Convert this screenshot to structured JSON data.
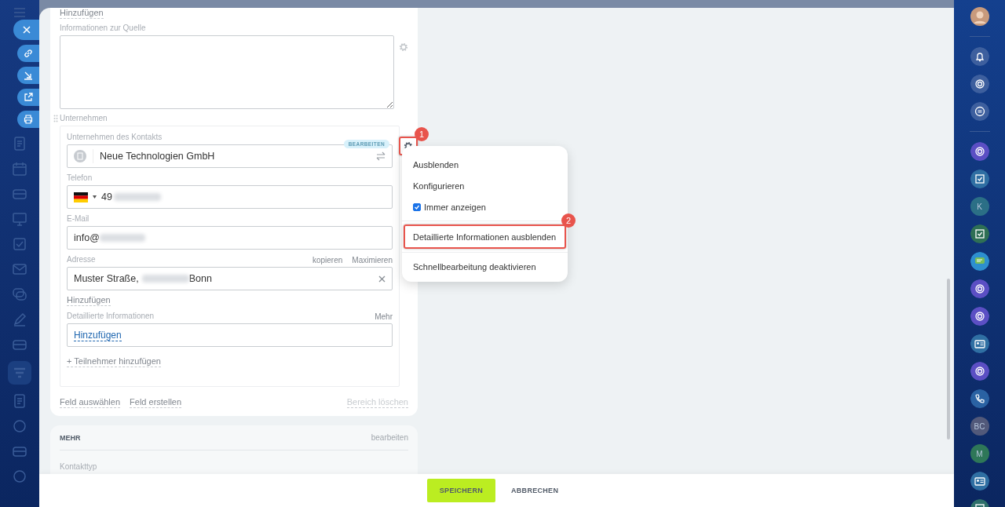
{
  "source_section": {
    "add_link": "Hinzufügen",
    "label": "Informationen zur Quelle"
  },
  "company_section": {
    "title": "Unternehmen",
    "field_label": "Unternehmen des Kontakts",
    "badge": "BEARBEITEN",
    "company": "Neue Technologien GmbH",
    "gear_callout": "1",
    "phone": {
      "label": "Telefon",
      "value": "49"
    },
    "email": {
      "label": "E-Mail",
      "value": "info@"
    },
    "address": {
      "label": "Adresse",
      "actions": [
        "kopieren",
        "Maximieren"
      ],
      "value_start": "Muster Straße,",
      "value_end": "Bonn"
    },
    "add_link": "Hinzufügen",
    "details": {
      "label": "Detaillierte Informationen",
      "action": "Mehr",
      "link": "Hinzufügen"
    },
    "add_participant": "+ Teilnehmer hinzufügen"
  },
  "card_actions": [
    {
      "label": "Feld auswählen",
      "disabled": false
    },
    {
      "label": "Feld erstellen",
      "disabled": false
    },
    {
      "label": "Bereich löschen",
      "disabled": true
    }
  ],
  "more_section": {
    "title": "MEHR",
    "action": "bearbeiten",
    "field_label": "Kontakttyp"
  },
  "menu": [
    {
      "kind": "item",
      "label": "Ausblenden"
    },
    {
      "kind": "item",
      "label": "Konfigurieren"
    },
    {
      "kind": "checkbox",
      "label": "Immer anzeigen",
      "checked": true
    },
    {
      "kind": "separator"
    },
    {
      "kind": "item",
      "label": "Detaillierte Informationen ausblenden",
      "callout": "2"
    },
    {
      "kind": "separator"
    },
    {
      "kind": "item",
      "label": "Schnellbearbeitung deaktivieren"
    }
  ],
  "footer": {
    "buttons": [
      {
        "kind": "primary",
        "label": "SPEICHERN"
      },
      {
        "kind": "secondary",
        "label": "ABBRECHEN"
      }
    ]
  },
  "right_sidebar": [
    {
      "kind": "avatar"
    },
    {
      "kind": "divider"
    },
    {
      "kind": "bell",
      "color": "#3d5f9e"
    },
    {
      "kind": "openline",
      "color": "#3d5f9e"
    },
    {
      "kind": "chat-search",
      "color": "#3d5f9e"
    },
    {
      "kind": "divider"
    },
    {
      "kind": "openline",
      "color": "#5b4fc4"
    },
    {
      "kind": "task",
      "color": "#2f6fa3"
    },
    {
      "kind": "letter",
      "text": "K",
      "color": "#2b6f86"
    },
    {
      "kind": "task",
      "color": "#2e6f55"
    },
    {
      "kind": "chat",
      "color": "#2d8fcf"
    },
    {
      "kind": "openline",
      "color": "#5b4fc4"
    },
    {
      "kind": "openline",
      "color": "#5b4fc4"
    },
    {
      "kind": "contact",
      "color": "#2f6fa3"
    },
    {
      "kind": "openline",
      "color": "#5b4fc4"
    },
    {
      "kind": "phone",
      "color": "#2a62a3"
    },
    {
      "kind": "letter",
      "text": "BC",
      "color": "#52597a"
    },
    {
      "kind": "letter",
      "text": "M",
      "color": "#2e7758"
    },
    {
      "kind": "contact",
      "color": "#2f6fa3"
    },
    {
      "kind": "task",
      "color": "#2e6f6a"
    }
  ]
}
